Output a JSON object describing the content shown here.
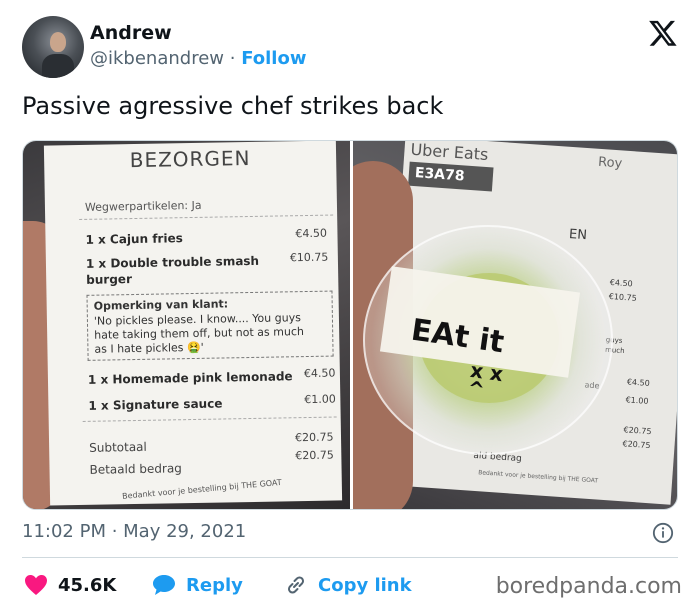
{
  "author": {
    "name": "Andrew",
    "handle": "@ikbenandrew",
    "separator": "·",
    "follow_label": "Follow"
  },
  "tweet_text": "Passive agressive chef strikes back",
  "left_receipt": {
    "header": "BEZORGEN",
    "disposables": "Wegwerpartikelen: Ja",
    "items": [
      {
        "name": "1 x Cajun fries",
        "price": "€4.50"
      },
      {
        "name": "1 x Double trouble smash",
        "name2": "burger",
        "price": "€10.75"
      },
      {
        "name": "1 x Homemade pink lemonade",
        "price": "€4.50"
      },
      {
        "name": "1 x Signature sauce",
        "price": "€1.00"
      }
    ],
    "note": {
      "title": "Opmerking van klant:",
      "lines": [
        "'No pickles please. I know.... You guys",
        "hate taking them off, but not as much",
        "as I hate pickles 🤮'"
      ]
    },
    "subtotal_label": "Subtotaal",
    "subtotal_value": "€20.75",
    "paid_label": "Betaald bedrag",
    "paid_value": "€20.75",
    "footer": "Bedankt voor je bestelling bij THE GOAT"
  },
  "right_photo": {
    "brand": "Uber Eats",
    "order_code": "E3A78",
    "customer": "Roy",
    "tape_text": "EAt it",
    "face": "x x\n^",
    "prices": [
      "€4.50",
      "€10.75",
      "€4.50",
      "€1.00",
      "€20.75",
      "€20.75"
    ],
    "fragments": [
      "EN",
      "guys",
      "much",
      "ade",
      "ald bedrag"
    ],
    "footer": "Bedankt voor je bestelling bij THE GOAT"
  },
  "timestamp": "11:02 PM · May 29, 2021",
  "actions": {
    "likes": "45.6K",
    "reply": "Reply",
    "copy_link": "Copy link"
  },
  "watermark": "boredpanda.com",
  "colors": {
    "accent": "#1d9bf0",
    "like": "#f91880",
    "text": "#0f1419",
    "muted": "#536471"
  },
  "icons": [
    "x-logo-icon",
    "info-icon",
    "heart-icon",
    "reply-bubble-icon",
    "link-icon"
  ]
}
